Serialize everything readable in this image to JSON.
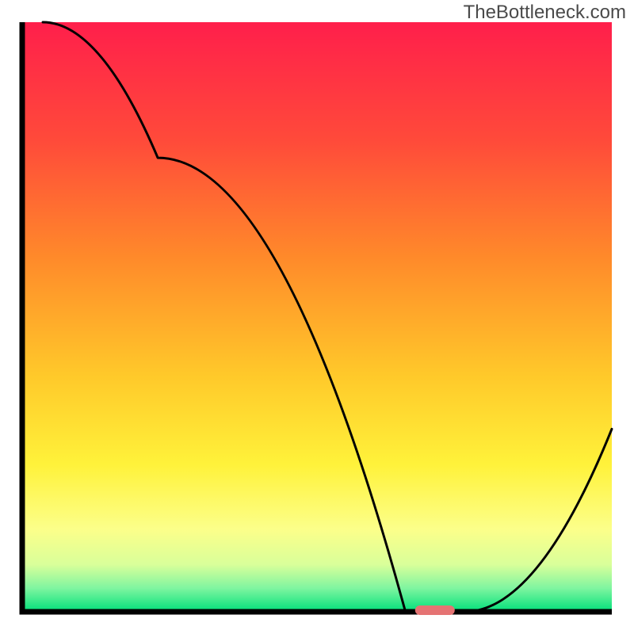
{
  "watermark": "TheBottleneck.com",
  "chart_data": {
    "type": "line",
    "title": "",
    "xlabel": "",
    "ylabel": "",
    "xlim": [
      0,
      100
    ],
    "ylim": [
      0,
      100
    ],
    "x": [
      3.5,
      23,
      65,
      70,
      75,
      100
    ],
    "y": [
      100,
      77,
      0,
      0,
      0,
      31
    ],
    "marker": {
      "x": 70,
      "y": 0
    },
    "gradient_stops": [
      {
        "offset": 0,
        "color": "#ff1f4b"
      },
      {
        "offset": 20,
        "color": "#ff4a3a"
      },
      {
        "offset": 40,
        "color": "#ff8a2a"
      },
      {
        "offset": 60,
        "color": "#ffc92a"
      },
      {
        "offset": 75,
        "color": "#fff23a"
      },
      {
        "offset": 86,
        "color": "#fcff8a"
      },
      {
        "offset": 92,
        "color": "#d9ff9a"
      },
      {
        "offset": 96,
        "color": "#7ff5a0"
      },
      {
        "offset": 100,
        "color": "#00e07a"
      }
    ],
    "axis_color": "#000000"
  }
}
